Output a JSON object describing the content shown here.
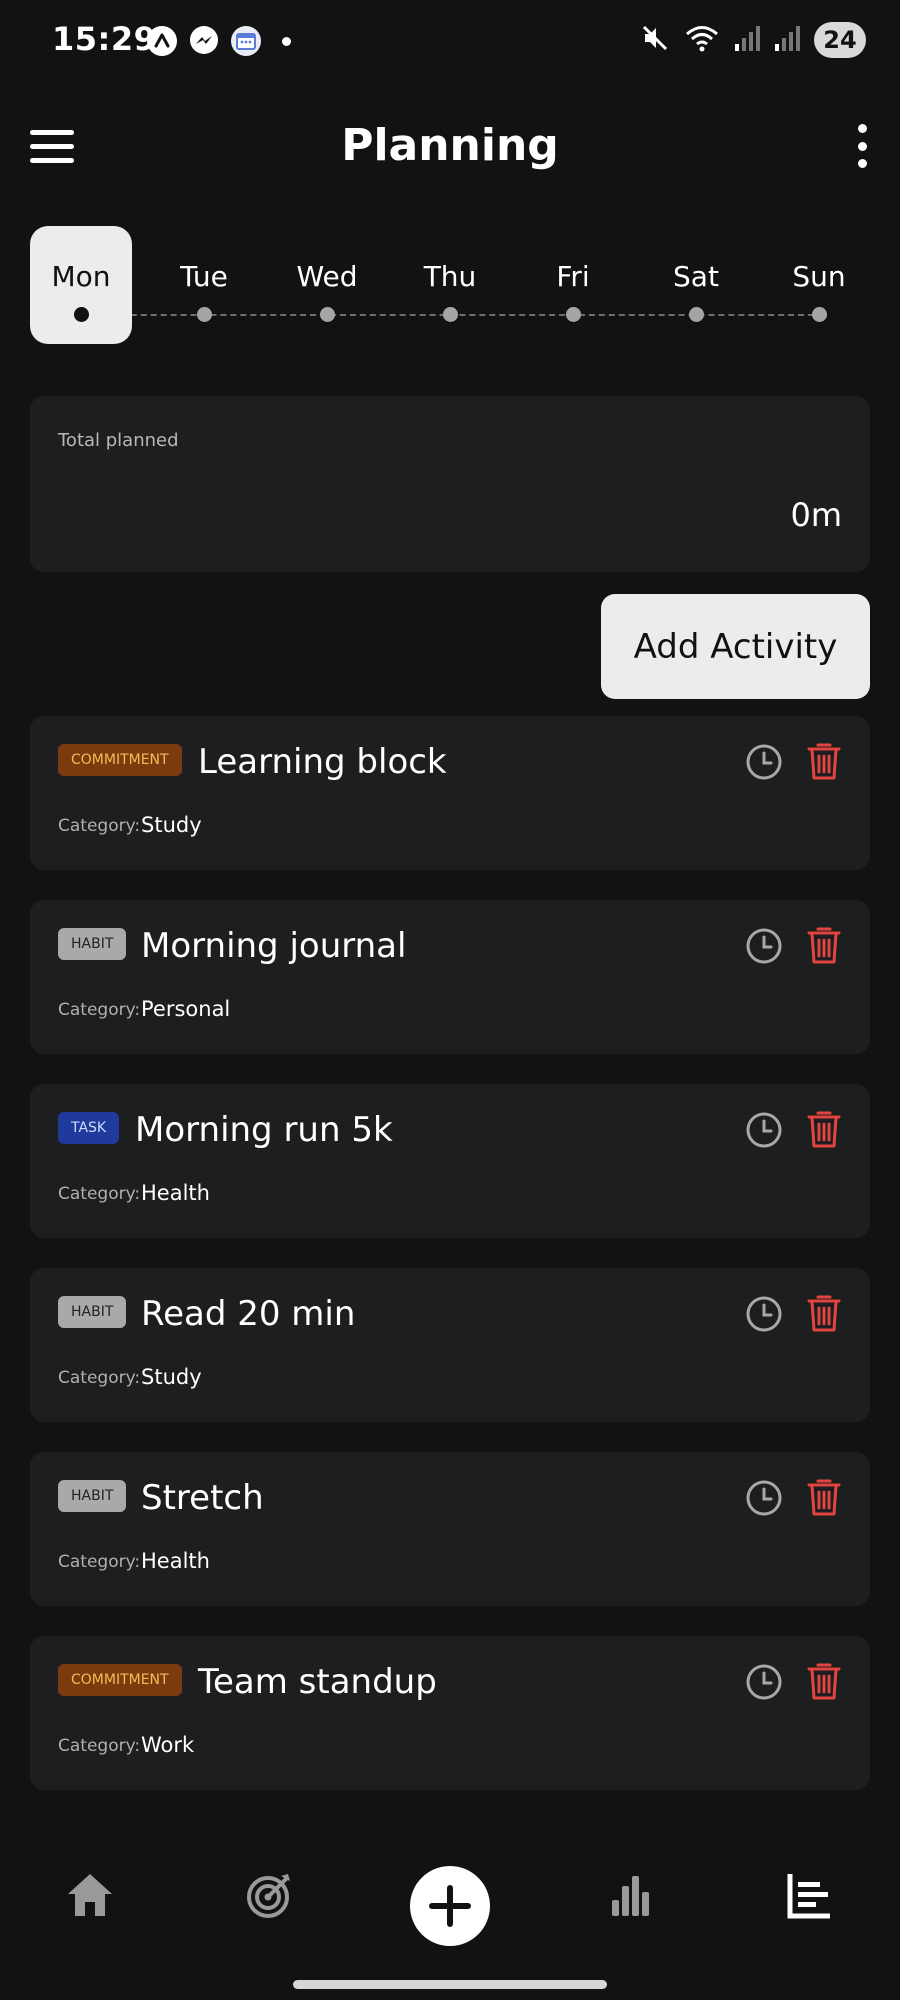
{
  "status_bar": {
    "time": "15:29",
    "battery": "24",
    "notification_icons": [
      "app-icon",
      "messenger-icon",
      "calendar-icon",
      "more-dot"
    ],
    "system_icons": [
      "mute-icon",
      "wifi-icon",
      "signal-icon",
      "signal-icon"
    ]
  },
  "header": {
    "title": "Planning"
  },
  "days": [
    {
      "label": "Mon",
      "selected": true
    },
    {
      "label": "Tue",
      "selected": false
    },
    {
      "label": "Wed",
      "selected": false
    },
    {
      "label": "Thu",
      "selected": false
    },
    {
      "label": "Fri",
      "selected": false
    },
    {
      "label": "Sat",
      "selected": false
    },
    {
      "label": "Sun",
      "selected": false
    }
  ],
  "summary": {
    "label": "Total planned",
    "value": "0m"
  },
  "add_button": {
    "label": "Add Activity"
  },
  "activities": [
    {
      "badge": "COMMITMENT",
      "type": "commitment",
      "title": "Learning block",
      "category_label": "Category:",
      "category": "Study"
    },
    {
      "badge": "HABIT",
      "type": "habit",
      "title": "Morning journal",
      "category_label": "Category:",
      "category": "Personal"
    },
    {
      "badge": "TASK",
      "type": "task",
      "title": "Morning run 5k",
      "category_label": "Category:",
      "category": "Health"
    },
    {
      "badge": "HABIT",
      "type": "habit",
      "title": "Read 20 min",
      "category_label": "Category:",
      "category": "Study"
    },
    {
      "badge": "HABIT",
      "type": "habit",
      "title": "Stretch",
      "category_label": "Category:",
      "category": "Health"
    },
    {
      "badge": "COMMITMENT",
      "type": "commitment",
      "title": "Team standup",
      "category_label": "Category:",
      "category": "Work"
    }
  ],
  "bottom_nav": [
    "home-icon",
    "target-icon",
    "add-icon",
    "stats-icon",
    "planning-icon"
  ],
  "colors": {
    "background": "#121212",
    "card": "#1d1e20",
    "accent_light": "#ececec",
    "delete": "#e0453f",
    "commitment_badge": "#7a3c0f",
    "habit_badge": "#a9a9a9",
    "task_badge": "#1f3a9a"
  }
}
